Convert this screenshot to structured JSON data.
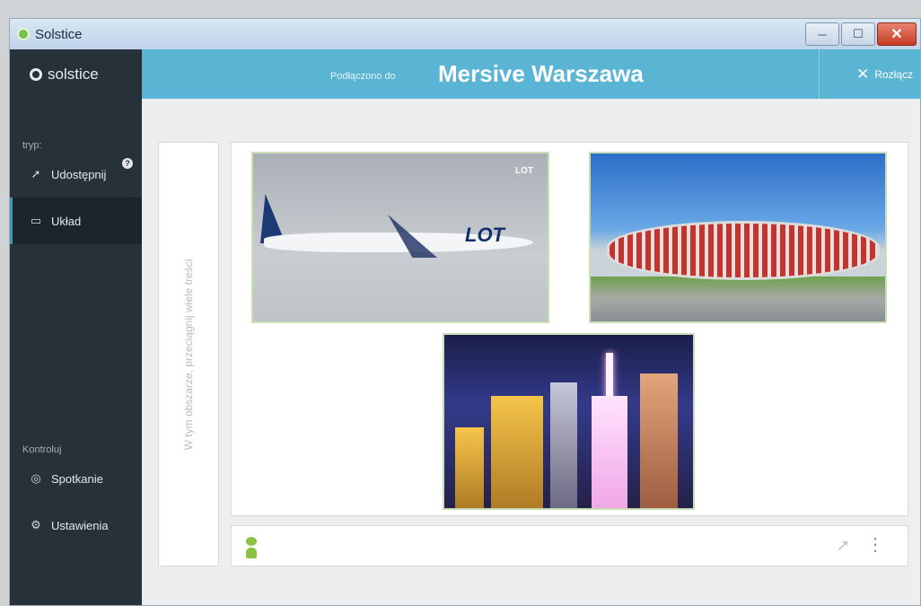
{
  "window": {
    "title": "Solstice",
    "controls": {
      "minimize": "─",
      "maximize": "☐",
      "close": "✕"
    }
  },
  "sidebar": {
    "logo_text": "solstice",
    "section_tryb": "tryp:",
    "items": [
      {
        "label": "Udostępnij",
        "icon": "share-icon",
        "badge": "?"
      },
      {
        "label": "Układ",
        "icon": "layout-icon",
        "active": true
      }
    ],
    "section_kontroluj": "Kontroluj",
    "controls": [
      {
        "label": "Spotkanie",
        "icon": "meeting-icon"
      },
      {
        "label": "Ustawienia",
        "icon": "gear-icon"
      }
    ]
  },
  "header": {
    "prefix": "Podłączono do",
    "room_name": "Mersive Warszawa",
    "disconnect_label": "Rozłącz"
  },
  "main": {
    "dropzone_text": "W tym obszarze, przeciągnij wiele treści",
    "thumbnails": [
      {
        "label": "LOT",
        "corner_text": "LOT"
      },
      {
        "label": "stadium"
      },
      {
        "label": "city"
      }
    ],
    "toolbar": {
      "share_icon": "send-icon",
      "more_icon": "more-vertical-icon"
    }
  },
  "colors": {
    "header_bg": "#5ab4d4",
    "sidebar_bg": "#26313a",
    "accent_green": "#8ac343"
  }
}
